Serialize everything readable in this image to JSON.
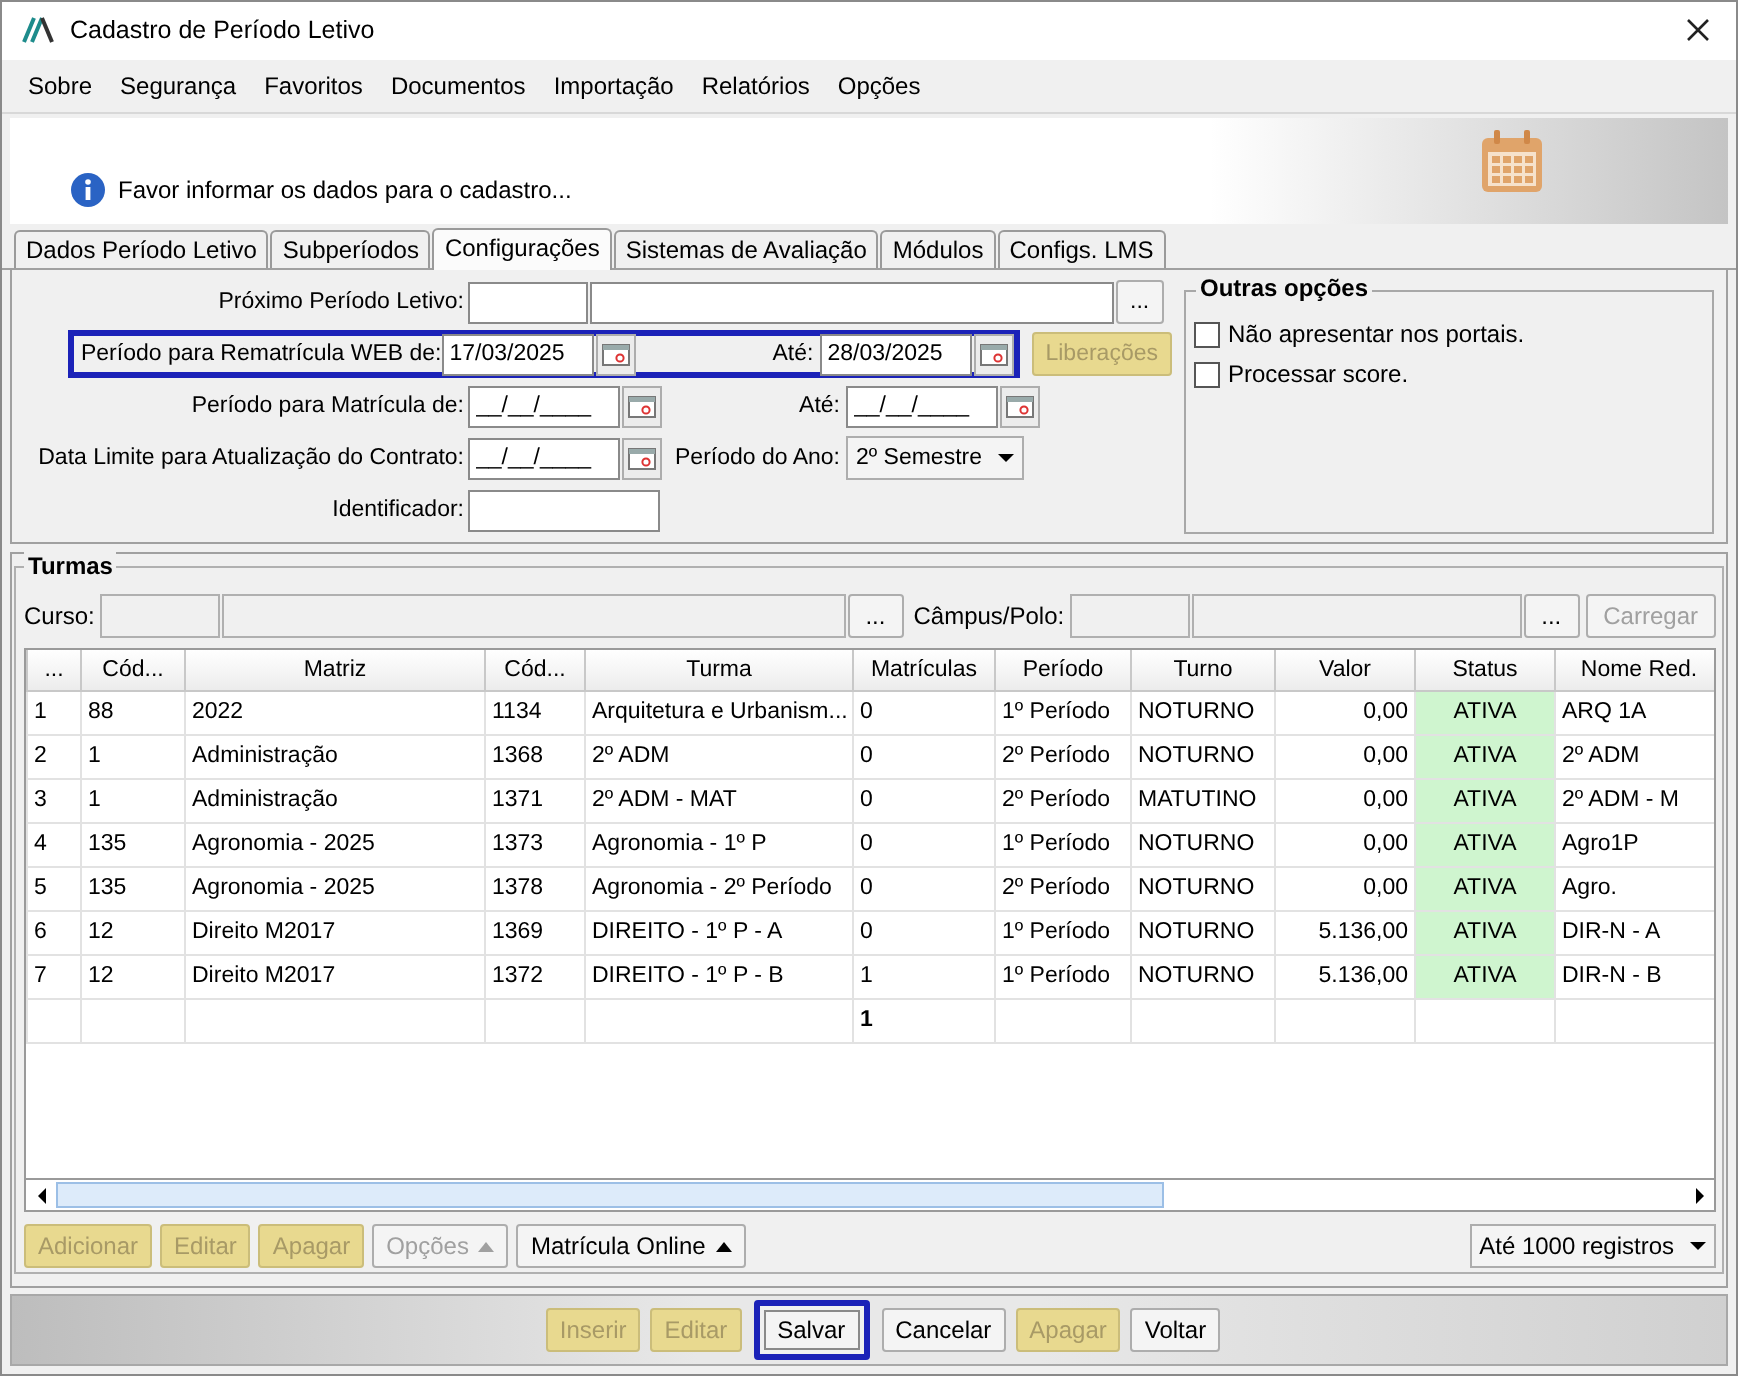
{
  "window": {
    "title": "Cadastro de Período Letivo"
  },
  "menu": [
    "Sobre",
    "Segurança",
    "Favoritos",
    "Documentos",
    "Importação",
    "Relatórios",
    "Opções"
  ],
  "info_message": "Favor informar os dados para o cadastro...",
  "tabs": [
    {
      "label": "Dados Período Letivo",
      "selected": false
    },
    {
      "label": "Subperíodos",
      "selected": false
    },
    {
      "label": "Configurações",
      "selected": true
    },
    {
      "label": "Sistemas de Avaliação",
      "selected": false
    },
    {
      "label": "Módulos",
      "selected": false
    },
    {
      "label": "Configs. LMS",
      "selected": false
    }
  ],
  "form": [
    {
      "kind": "lookup",
      "label": "Próximo Período Letivo:",
      "lookup_button": "...",
      "highlighted": false
    },
    {
      "kind": "date_range",
      "label": "Período para Rematrícula WEB de:",
      "from": "17/03/2025",
      "to_label": "Até:",
      "to": "28/03/2025",
      "highlighted": true,
      "action_button": {
        "label": "Liberações",
        "disabled": true
      }
    },
    {
      "kind": "date_range",
      "label": "Período para Matrícula de:",
      "from": "__/__/____",
      "to_label": "Até:",
      "to": "__/__/____",
      "highlighted": false
    },
    {
      "kind": "date_select",
      "label": "Data Limite para Atualização do Contrato:",
      "from": "__/__/____",
      "select_label": "Período do Ano:",
      "select": "2º Semestre",
      "highlighted": false
    },
    {
      "kind": "text",
      "label": "Identificador:",
      "highlighted": false
    }
  ],
  "other_options": {
    "title": "Outras opções",
    "options": [
      {
        "label": "Não apresentar nos portais.",
        "checked": false
      },
      {
        "label": "Processar score.",
        "checked": false
      }
    ]
  },
  "turmas": {
    "title": "Turmas",
    "course_label": "Curso:",
    "course_button": "...",
    "campus_label": "Câmpus/Polo:",
    "campus_button": "...",
    "load_button": {
      "label": "Carregar",
      "disabled": true
    },
    "table": {
      "columns": [
        {
          "label": "...",
          "kind": "text"
        },
        {
          "label": "Cód...",
          "kind": "text"
        },
        {
          "label": "Matriz",
          "kind": "text"
        },
        {
          "label": "Cód...",
          "kind": "text"
        },
        {
          "label": "Turma",
          "kind": "text"
        },
        {
          "label": "Matrículas",
          "kind": "text",
          "total": "1"
        },
        {
          "label": "Período",
          "kind": "text"
        },
        {
          "label": "Turno",
          "kind": "text"
        },
        {
          "label": "Valor",
          "kind": "number"
        },
        {
          "label": "Status",
          "kind": "status"
        },
        {
          "label": "Nome Red.",
          "kind": "text"
        }
      ],
      "rows": [
        [
          "1",
          "88",
          "2022",
          "1134",
          "Arquitetura e Urbanism...",
          "0",
          "1º Período",
          "NOTURNO",
          "0,00",
          "ATIVA",
          "ARQ 1A"
        ],
        [
          "2",
          "1",
          "Administração",
          "1368",
          "2º ADM",
          "0",
          "2º Período",
          "NOTURNO",
          "0,00",
          "ATIVA",
          "2º ADM"
        ],
        [
          "3",
          "1",
          "Administração",
          "1371",
          "2º ADM - MAT",
          "0",
          "2º Período",
          "MATUTINO",
          "0,00",
          "ATIVA",
          "2º ADM - M"
        ],
        [
          "4",
          "135",
          "Agronomia - 2025",
          "1373",
          "Agronomia - 1º P",
          "0",
          "1º Período",
          "NOTURNO",
          "0,00",
          "ATIVA",
          "Agro1P"
        ],
        [
          "5",
          "135",
          "Agronomia - 2025",
          "1378",
          "Agronomia - 2º Período",
          "0",
          "2º Período",
          "NOTURNO",
          "0,00",
          "ATIVA",
          "Agro."
        ],
        [
          "6",
          "12",
          "Direito M2017",
          "1369",
          "DIREITO - 1º P - A",
          "0",
          "1º Período",
          "NOTURNO",
          "5.136,00",
          "ATIVA",
          "DIR-N - A"
        ],
        [
          "7",
          "12",
          "Direito M2017",
          "1372",
          "DIREITO - 1º P - B",
          "1",
          "1º Período",
          "NOTURNO",
          "5.136,00",
          "ATIVA",
          "DIR-N - B"
        ]
      ]
    },
    "actions": [
      {
        "label": "Adicionar",
        "kind": "button",
        "disabled": true
      },
      {
        "label": "Editar",
        "kind": "button",
        "disabled": true
      },
      {
        "label": "Apagar",
        "kind": "button",
        "disabled": true
      },
      {
        "label": "Opções",
        "kind": "menu",
        "disabled": true
      },
      {
        "label": "Matrícula Online",
        "kind": "menu",
        "disabled": false
      }
    ],
    "records_select": "Até 1000 registros"
  },
  "bottom_buttons": [
    {
      "label": "Inserir",
      "disabled": true,
      "highlighted": false
    },
    {
      "label": "Editar",
      "disabled": true,
      "highlighted": false
    },
    {
      "label": "Salvar",
      "disabled": false,
      "highlighted": true
    },
    {
      "label": "Cancelar",
      "disabled": false,
      "highlighted": false
    },
    {
      "label": "Apagar",
      "disabled": true,
      "highlighted": false
    },
    {
      "label": "Voltar",
      "disabled": false,
      "highlighted": false
    }
  ]
}
